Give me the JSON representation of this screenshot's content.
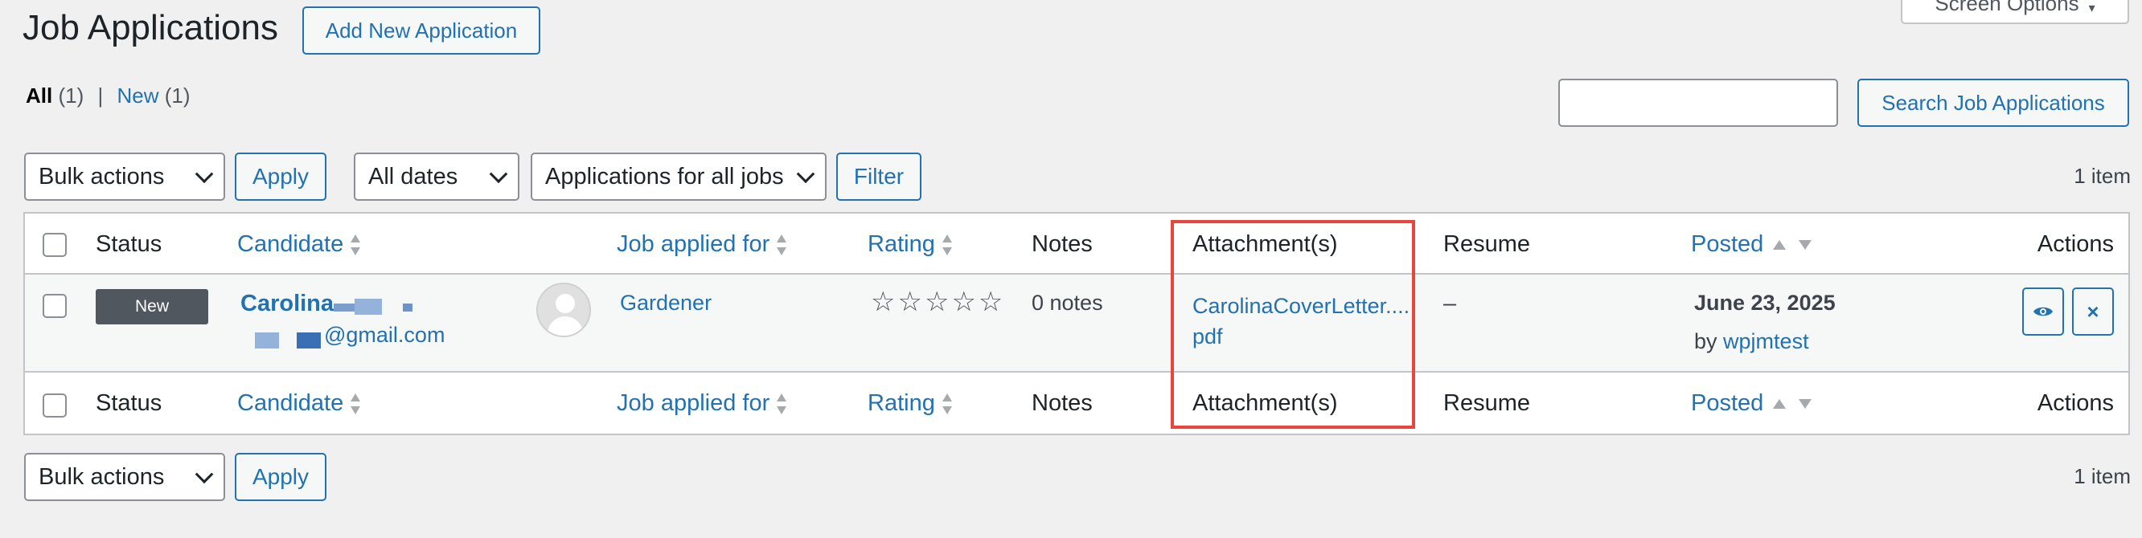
{
  "page": {
    "title": "Job Applications",
    "add_new_label": "Add New Application",
    "screen_options_label": "Screen Options"
  },
  "views": [
    {
      "label": "All",
      "count": "(1)"
    },
    {
      "label": "New",
      "count": "(1)"
    }
  ],
  "views_separator": "|",
  "search": {
    "value": "",
    "button_label": "Search Job Applications"
  },
  "tablenav_top": {
    "bulk_actions": "Bulk actions",
    "apply_label": "Apply",
    "dates_filter": "All dates",
    "jobs_filter": "Applications for all jobs",
    "filter_label": "Filter",
    "item_count": "1 item"
  },
  "tablenav_bottom": {
    "bulk_actions": "Bulk actions",
    "apply_label": "Apply",
    "item_count": "1 item"
  },
  "columns": {
    "status": "Status",
    "candidate": "Candidate",
    "job": "Job applied for",
    "rating": "Rating",
    "notes": "Notes",
    "attachments": "Attachment(s)",
    "resume": "Resume",
    "posted": "Posted",
    "actions": "Actions"
  },
  "rows": [
    {
      "status": "New",
      "candidate_name": "Carolina",
      "candidate_email": "@gmail.com",
      "job": "Gardener",
      "rating_stars": "☆☆☆☆☆",
      "notes": "0 notes",
      "attachment_line1": "CarolinaCoverLetter....",
      "attachment_line2": "pdf",
      "resume": "–",
      "posted_date": "June 23, 2025",
      "posted_by_prefix": "by",
      "posted_by_user": "wpjmtest",
      "view_icon": "eye-icon",
      "delete_icon": "close-icon"
    }
  ],
  "colors": {
    "accent": "#2271b1",
    "highlight_box": "#e8453c",
    "badge_bg": "#50575e"
  }
}
